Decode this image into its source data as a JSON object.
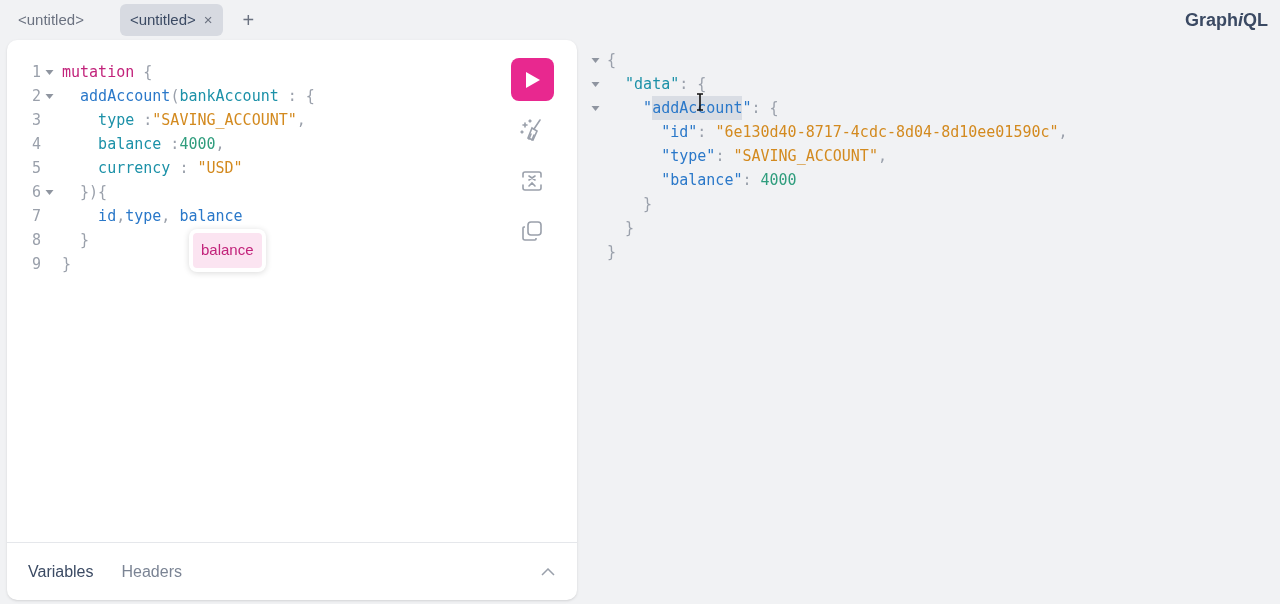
{
  "tabs": [
    {
      "label": "<untitled>",
      "selected": false,
      "closable": false
    },
    {
      "label": "<untitled>",
      "selected": true,
      "closable": true,
      "close": "×"
    }
  ],
  "add_tab": "+",
  "logo": {
    "text": "Graph",
    "italic": "i",
    "rest": "QL"
  },
  "editor": {
    "lines": [
      {
        "number": "1",
        "foldable": true,
        "tokens": [
          {
            "kind": "keyword",
            "text": "mutation"
          },
          {
            "kind": "punct",
            "text": " {"
          }
        ]
      },
      {
        "number": "2",
        "foldable": true,
        "tokens": [
          {
            "kind": "def",
            "text": "  addAccount"
          },
          {
            "kind": "punct",
            "text": "("
          },
          {
            "kind": "field",
            "text": "bankAccount"
          },
          {
            "kind": "punct",
            "text": " : {"
          }
        ]
      },
      {
        "number": "3",
        "foldable": false,
        "tokens": [
          {
            "kind": "field",
            "text": "    type"
          },
          {
            "kind": "punct",
            "text": " :"
          },
          {
            "kind": "string",
            "text": "\"SAVING_ACCOUNT\""
          },
          {
            "kind": "punct",
            "text": ","
          }
        ]
      },
      {
        "number": "4",
        "foldable": false,
        "tokens": [
          {
            "kind": "field",
            "text": "    balance"
          },
          {
            "kind": "punct",
            "text": " :"
          },
          {
            "kind": "number",
            "text": "4000"
          },
          {
            "kind": "punct",
            "text": ","
          }
        ]
      },
      {
        "number": "5",
        "foldable": false,
        "tokens": [
          {
            "kind": "field",
            "text": "    currency"
          },
          {
            "kind": "punct",
            "text": " : "
          },
          {
            "kind": "string",
            "text": "\"USD\""
          }
        ]
      },
      {
        "number": "6",
        "foldable": true,
        "tokens": [
          {
            "kind": "punct",
            "text": "  }){"
          }
        ]
      },
      {
        "number": "7",
        "foldable": false,
        "tokens": [
          {
            "kind": "def",
            "text": "    id"
          },
          {
            "kind": "punct",
            "text": ","
          },
          {
            "kind": "def",
            "text": "type"
          },
          {
            "kind": "punct",
            "text": ", "
          },
          {
            "kind": "def",
            "text": "balance"
          }
        ]
      },
      {
        "number": "8",
        "foldable": false,
        "tokens": [
          {
            "kind": "punct",
            "text": "  }"
          }
        ]
      },
      {
        "number": "9",
        "foldable": false,
        "tokens": [
          {
            "kind": "punct",
            "text": "}"
          }
        ]
      }
    ],
    "suggestions": [
      {
        "label": "balance",
        "selected": true
      }
    ]
  },
  "bottom_tabs": [
    {
      "label": "Variables",
      "selected": true
    },
    {
      "label": "Headers",
      "selected": false
    }
  ],
  "result": {
    "lines": [
      {
        "foldable": true,
        "tokens": [
          {
            "kind": "punct",
            "text": "{"
          }
        ]
      },
      {
        "foldable": true,
        "tokens": [
          {
            "kind": "field",
            "text": "  \"data\""
          },
          {
            "kind": "punct",
            "text": ": {"
          }
        ]
      },
      {
        "foldable": true,
        "tokens": [
          {
            "kind": "def",
            "text": "    \""
          },
          {
            "kind": "def",
            "text": "addAccount",
            "selected": true
          },
          {
            "kind": "def",
            "text": "\""
          },
          {
            "kind": "punct",
            "text": ": {"
          }
        ]
      },
      {
        "foldable": false,
        "tokens": [
          {
            "kind": "def",
            "text": "      \"id\""
          },
          {
            "kind": "punct",
            "text": ": "
          },
          {
            "kind": "string",
            "text": "\"6e130d40-8717-4cdc-8d04-8d10ee01590c\""
          },
          {
            "kind": "punct",
            "text": ","
          }
        ]
      },
      {
        "foldable": false,
        "tokens": [
          {
            "kind": "def",
            "text": "      \"type\""
          },
          {
            "kind": "punct",
            "text": ": "
          },
          {
            "kind": "string",
            "text": "\"SAVING_ACCOUNT\""
          },
          {
            "kind": "punct",
            "text": ","
          }
        ]
      },
      {
        "foldable": false,
        "tokens": [
          {
            "kind": "def",
            "text": "      \"balance\""
          },
          {
            "kind": "punct",
            "text": ": "
          },
          {
            "kind": "number",
            "text": "4000"
          }
        ]
      },
      {
        "foldable": false,
        "tokens": [
          {
            "kind": "punct",
            "text": "    }"
          }
        ]
      },
      {
        "foldable": false,
        "tokens": [
          {
            "kind": "punct",
            "text": "  }"
          }
        ]
      },
      {
        "foldable": false,
        "tokens": [
          {
            "kind": "punct",
            "text": "}"
          }
        ]
      }
    ]
  }
}
